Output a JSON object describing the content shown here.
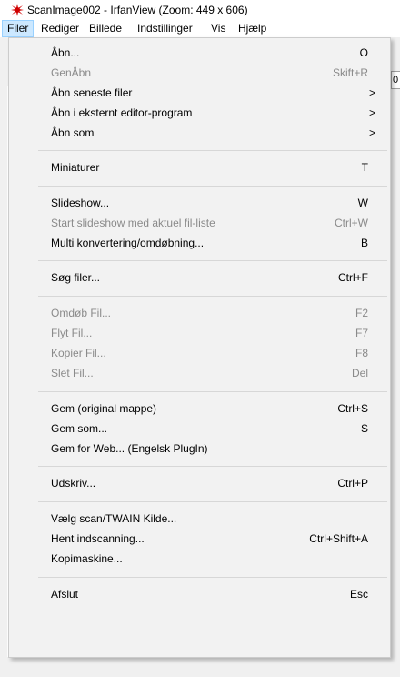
{
  "window": {
    "title": "ScanImage002 - IrfanView (Zoom: 449 x 606)",
    "icon": "irfanview-red-splat-icon"
  },
  "menubar": {
    "items": [
      {
        "label": "Filer",
        "active": true
      },
      {
        "label": "Rediger"
      },
      {
        "label": "Billede"
      },
      {
        "label": "Indstillinger"
      },
      {
        "label": "Vis"
      },
      {
        "label": "Hjælp"
      }
    ]
  },
  "toolbar": {
    "partial_field_text": "0"
  },
  "file_menu": {
    "items": [
      {
        "label": "Åbn...",
        "shortcut": "O"
      },
      {
        "label": "GenÅbn",
        "shortcut": "Skift+R",
        "disabled": true
      },
      {
        "label": "Åbn seneste filer",
        "submenu": true
      },
      {
        "label": "Åbn i eksternt editor-program",
        "submenu": true
      },
      {
        "label": "Åbn som",
        "submenu": true
      },
      {
        "label": "Miniaturer",
        "shortcut": "T"
      },
      {
        "label": "Slideshow...",
        "shortcut": "W"
      },
      {
        "label": "Start slideshow med aktuel fil-liste",
        "shortcut": "Ctrl+W",
        "disabled": true
      },
      {
        "label": "Multi konvertering/omdøbning...",
        "shortcut": "B"
      },
      {
        "label": "Søg filer...",
        "shortcut": "Ctrl+F"
      },
      {
        "label": "Omdøb Fil...",
        "shortcut": "F2",
        "disabled": true
      },
      {
        "label": "Flyt Fil...",
        "shortcut": "F7",
        "disabled": true
      },
      {
        "label": "Kopier Fil...",
        "shortcut": "F8",
        "disabled": true
      },
      {
        "label": "Slet Fil...",
        "shortcut": "Del",
        "disabled": true
      },
      {
        "label": "Gem (original mappe)",
        "shortcut": "Ctrl+S"
      },
      {
        "label": "Gem som...",
        "shortcut": "S"
      },
      {
        "label": "Gem for Web... (Engelsk PlugIn)"
      },
      {
        "label": "Udskriv...",
        "shortcut": "Ctrl+P"
      },
      {
        "label": "Vælg scan/TWAIN Kilde..."
      },
      {
        "label": "Hent indscanning...",
        "shortcut": "Ctrl+Shift+A"
      },
      {
        "label": "Kopimaskine..."
      },
      {
        "label": "Afslut",
        "shortcut": "Esc"
      }
    ],
    "submenu_arrow": ">"
  },
  "colors": {
    "menu_background": "#f2f2f2",
    "active_menubar_highlight": "#cce8ff",
    "disabled_text": "#8a8a8a"
  }
}
